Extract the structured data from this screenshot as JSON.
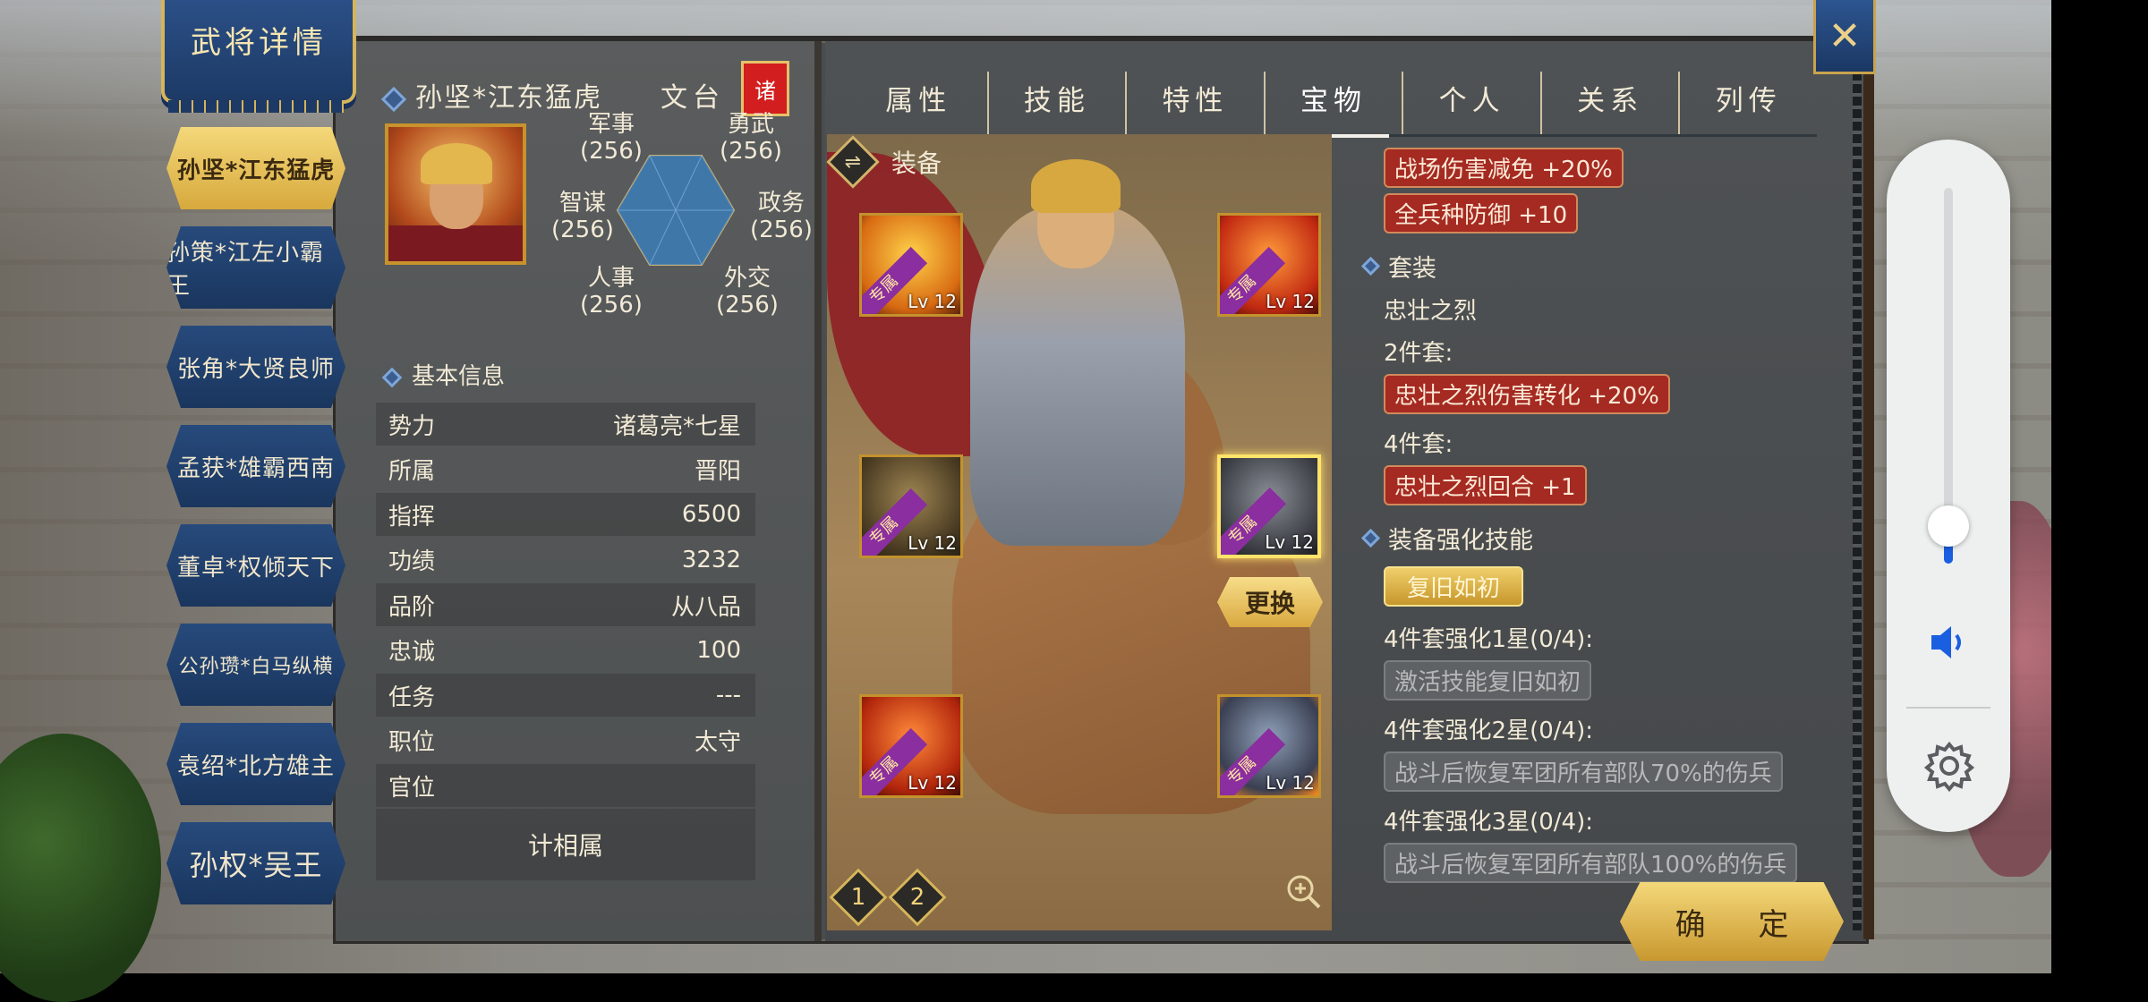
{
  "title_banner": "武将详情",
  "generals": [
    {
      "label": "孙坚*江东猛虎",
      "selected": true
    },
    {
      "label": "孙策*江左小霸王",
      "selected": false
    },
    {
      "label": "张角*大贤良师",
      "selected": false
    },
    {
      "label": "孟获*雄霸西南",
      "selected": false
    },
    {
      "label": "董卓*权倾天下",
      "selected": false
    },
    {
      "label": "公孙瓒*白马纵横",
      "selected": false
    },
    {
      "label": "袁绍*北方雄主",
      "selected": false
    },
    {
      "label": "孙权*吴王",
      "selected": false
    }
  ],
  "hero": {
    "name": "孙坚*江东猛虎",
    "job": "文台",
    "faction_tag": "诸"
  },
  "stats": {
    "military": {
      "label": "军事",
      "value": "(256)"
    },
    "valor": {
      "label": "勇武",
      "value": "(256)"
    },
    "strategy": {
      "label": "智谋",
      "value": "(256)"
    },
    "politics": {
      "label": "政务",
      "value": "(256)"
    },
    "personnel": {
      "label": "人事",
      "value": "(256)"
    },
    "diplomacy": {
      "label": "外交",
      "value": "(256)"
    },
    "hex_fill": 1.0
  },
  "basic_info": {
    "title": "基本信息",
    "rows": [
      {
        "label": "势力",
        "value": "诸葛亮*七星"
      },
      {
        "label": "所属",
        "value": "晋阳"
      },
      {
        "label": "指挥",
        "value": "6500"
      },
      {
        "label": "功绩",
        "value": "3232"
      },
      {
        "label": "品阶",
        "value": "从八品"
      },
      {
        "label": "忠诚",
        "value": "100"
      },
      {
        "label": "任务",
        "value": "---"
      },
      {
        "label": "职位",
        "value": "太守"
      },
      {
        "label": "官位",
        "value": ""
      }
    ],
    "relate_button": "计相属"
  },
  "tabs": [
    {
      "label": "属性",
      "selected": false
    },
    {
      "label": "技能",
      "selected": false
    },
    {
      "label": "特性",
      "selected": false
    },
    {
      "label": "宝物",
      "selected": true
    },
    {
      "label": "个人",
      "selected": false
    },
    {
      "label": "关系",
      "selected": false
    },
    {
      "label": "列传",
      "selected": false
    }
  ],
  "equipment": {
    "title": "装备",
    "swap_icon": "⇌",
    "slot_tag": "专属",
    "slots": [
      {
        "name": "weapon-slot",
        "level": "Lv 12"
      },
      {
        "name": "spear-slot",
        "level": "Lv 12"
      },
      {
        "name": "horse-slot",
        "level": "Lv 12"
      },
      {
        "name": "armor-slot",
        "level": "Lv 12",
        "highlighted": true
      },
      {
        "name": "dragon-slot",
        "level": "Lv 12"
      },
      {
        "name": "seal-slot",
        "level": "Lv 12"
      }
    ],
    "replace_button": "更换",
    "pages": [
      "1",
      "2"
    ]
  },
  "effects": {
    "bonuses": [
      "战场伤害减免 +20%",
      "全兵种防御 +10"
    ],
    "set_title": "套装",
    "set_name": "忠壮之烈",
    "two_piece_label": "2件套:",
    "two_piece_bonus": "忠壮之烈伤害转化 +20%",
    "four_piece_label": "4件套:",
    "four_piece_bonus": "忠壮之烈回合 +1",
    "enhance_title": "装备强化技能",
    "enhance_skill": "复旧如初",
    "tiers": [
      {
        "label": "4件套强化1星(0/4):",
        "desc": "激活技能复旧如初"
      },
      {
        "label": "4件套强化2星(0/4):",
        "desc": "战斗后恢复军团所有部队70%的伤兵"
      },
      {
        "label": "4件套强化3星(0/4):",
        "desc": "战斗后恢复军团所有部队100%的伤兵"
      }
    ]
  },
  "confirm_button": "确 定",
  "close_icon": "✕",
  "volume": {
    "level": 0.1
  },
  "colors": {
    "accent_gold": "#d7a93d",
    "navy": "#1d3a66",
    "badge_red": "#a52a22",
    "volume_blue": "#1a5fe0"
  }
}
